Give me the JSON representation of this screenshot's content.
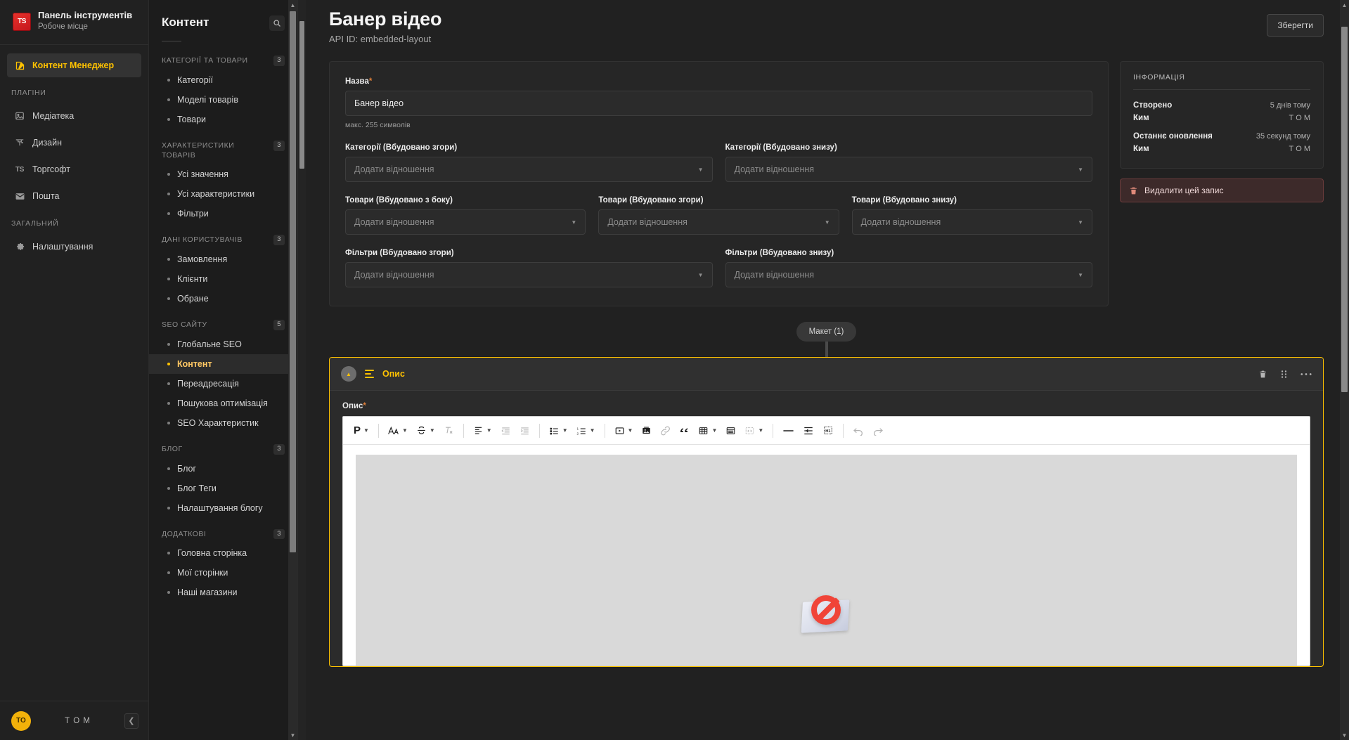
{
  "brand": {
    "logo_text": "TS",
    "title": "Панель інструментів",
    "subtitle": "Робоче місце"
  },
  "leftnav": {
    "primary": {
      "label": "Контент Менеджер",
      "icon": "pencil-square-icon"
    },
    "sections": [
      {
        "heading": "ПЛАГІНИ",
        "items": [
          {
            "label": "Медіатека",
            "icon": "image-icon"
          },
          {
            "label": "Дизайн",
            "icon": "design-icon"
          },
          {
            "label": "Торгсофт",
            "icon": "ts-icon"
          },
          {
            "label": "Пошта",
            "icon": "mail-icon"
          }
        ]
      },
      {
        "heading": "ЗАГАЛЬНИЙ",
        "items": [
          {
            "label": "Налаштування",
            "icon": "gear-icon"
          }
        ]
      }
    ],
    "footer": {
      "avatar_initials": "ТО",
      "user": "Т О М",
      "collapse_icon": "chevron-left-icon"
    }
  },
  "listpane": {
    "title": "Контент",
    "search_icon": "search-icon",
    "groups": [
      {
        "heading": "КАТЕГОРІЇ ТА ТОВАРИ",
        "count": "3",
        "items": [
          {
            "label": "Категорії",
            "active": false
          },
          {
            "label": "Моделі товарів",
            "active": false
          },
          {
            "label": "Товари",
            "active": false
          }
        ]
      },
      {
        "heading": "ХАРАКТЕРИСТИКИ ТОВАРІВ",
        "count": "3",
        "items": [
          {
            "label": "Усі значення",
            "active": false
          },
          {
            "label": "Усі характеристики",
            "active": false
          },
          {
            "label": "Фільтри",
            "active": false
          }
        ]
      },
      {
        "heading": "ДАНІ КОРИСТУВАЧІВ",
        "count": "3",
        "items": [
          {
            "label": "Замовлення",
            "active": false
          },
          {
            "label": "Клієнти",
            "active": false
          },
          {
            "label": "Обране",
            "active": false
          }
        ]
      },
      {
        "heading": "SEO САЙТУ",
        "count": "5",
        "items": [
          {
            "label": "Глобальне SEO",
            "active": false
          },
          {
            "label": "Контент",
            "active": true
          },
          {
            "label": "Переадресація",
            "active": false
          },
          {
            "label": "Пошукова оптимізація",
            "active": false
          },
          {
            "label": "SEO Характеристик",
            "active": false
          }
        ]
      },
      {
        "heading": "БЛОГ",
        "count": "3",
        "items": [
          {
            "label": "Блог",
            "active": false
          },
          {
            "label": "Блог Теги",
            "active": false
          },
          {
            "label": "Налаштування блогу",
            "active": false
          }
        ]
      },
      {
        "heading": "ДОДАТКОВІ",
        "count": "3",
        "items": [
          {
            "label": "Головна сторінка",
            "active": false
          },
          {
            "label": "Мої сторінки",
            "active": false
          },
          {
            "label": "Наші магазини",
            "active": false
          }
        ]
      }
    ]
  },
  "header": {
    "title": "Банер відео",
    "api_id": "API ID: embedded-layout",
    "save_label": "Зберегти"
  },
  "form": {
    "name_label": "Назва",
    "name_required": "*",
    "name_value": "Банер відео",
    "name_hint": "макс. 255 символів",
    "relation_placeholder": "Додати відношення",
    "rows": [
      [
        {
          "label": "Категорії (Вбудовано згори)",
          "placeholder": "Додати відношення"
        },
        {
          "label": "Категорії (Вбудовано знизу)",
          "placeholder": "Додати відношення"
        }
      ],
      [
        {
          "label": "Товари (Вбудовано з боку)",
          "placeholder": "Додати відношення"
        },
        {
          "label": "Товари (Вбудовано згори)",
          "placeholder": "Додати відношення"
        },
        {
          "label": "Товари (Вбудовано знизу)",
          "placeholder": "Додати відношення"
        }
      ],
      [
        {
          "label": "Фільтри (Вбудовано згори)",
          "placeholder": "Додати відношення"
        },
        {
          "label": "Фільтри (Вбудовано знизу)",
          "placeholder": "Додати відношення"
        }
      ]
    ]
  },
  "info": {
    "heading": "ІНФОРМАЦІЯ",
    "rows": [
      {
        "key": "Створено",
        "value": "5 днів тому"
      },
      {
        "key": "Ким",
        "value": "Т О М"
      },
      {
        "key": "Останнє оновлення",
        "value": "35 секунд тому"
      },
      {
        "key": "Ким",
        "value": "Т О М"
      }
    ],
    "delete_label": "Видалити цей запис",
    "delete_icon": "trash-icon"
  },
  "dynamic_zone": {
    "badge": "Макет (1)",
    "component": {
      "name": "Опис",
      "collapse_icon": "chevron-up-icon",
      "drag_icon": "drag-lines-icon",
      "actions": [
        {
          "icon": "trash-icon",
          "name": "delete-component"
        },
        {
          "icon": "grid-dots-icon",
          "name": "reorder-component"
        },
        {
          "icon": "ellipsis-icon",
          "name": "more-options"
        }
      ]
    },
    "editor": {
      "field_label": "Опис",
      "field_required": "*",
      "toolbar": [
        {
          "icon": "paragraph-icon",
          "glyph": "P",
          "caret": true,
          "name": "paragraph-style"
        },
        {
          "sep": true
        },
        {
          "icon": "font-size-icon",
          "glyph": "Aa",
          "caret": true,
          "name": "font-size"
        },
        {
          "icon": "strikethrough-icon",
          "glyph": "S",
          "caret": true,
          "name": "strikethrough"
        },
        {
          "icon": "clear-format-icon",
          "glyph": "Tx",
          "caret": false,
          "name": "clear-formatting",
          "dim": true
        },
        {
          "sep": true
        },
        {
          "icon": "align-icon",
          "glyph": "align",
          "caret": true,
          "name": "text-align"
        },
        {
          "icon": "outdent-icon",
          "glyph": "outdent",
          "caret": false,
          "name": "decrease-indent",
          "dim": true
        },
        {
          "icon": "indent-icon",
          "glyph": "indent",
          "caret": false,
          "name": "increase-indent",
          "dim": true
        },
        {
          "sep": true
        },
        {
          "icon": "bullet-list-icon",
          "glyph": "ul",
          "caret": true,
          "name": "bullet-list"
        },
        {
          "icon": "numbered-list-icon",
          "glyph": "ol",
          "caret": true,
          "name": "numbered-list"
        },
        {
          "sep": true
        },
        {
          "icon": "video-icon",
          "glyph": "video",
          "caret": true,
          "name": "insert-video"
        },
        {
          "icon": "image-icon",
          "glyph": "image",
          "caret": false,
          "name": "insert-image"
        },
        {
          "icon": "link-icon",
          "glyph": "link",
          "caret": false,
          "name": "insert-link",
          "dim": true
        },
        {
          "icon": "quote-icon",
          "glyph": "quote",
          "caret": false,
          "name": "blockquote"
        },
        {
          "icon": "table-icon",
          "glyph": "table",
          "caret": true,
          "name": "insert-table"
        },
        {
          "icon": "html-icon",
          "glyph": "html",
          "caret": false,
          "name": "html-block"
        },
        {
          "icon": "code-embed-icon",
          "glyph": "embed",
          "caret": true,
          "name": "code-embed",
          "dim": true
        },
        {
          "sep": true
        },
        {
          "icon": "horizontal-rule-icon",
          "glyph": "hr",
          "caret": false,
          "name": "horizontal-rule"
        },
        {
          "icon": "page-break-icon",
          "glyph": "pagebreak",
          "caret": false,
          "name": "page-break"
        },
        {
          "icon": "heading-icon",
          "glyph": "H1",
          "caret": false,
          "name": "heading-block"
        },
        {
          "sep": true
        },
        {
          "icon": "undo-icon",
          "glyph": "undo",
          "caret": false,
          "name": "undo",
          "dim": true
        },
        {
          "icon": "redo-icon",
          "glyph": "redo",
          "caret": false,
          "name": "redo",
          "dim": true
        }
      ],
      "canvas_content_icon": "broken-image-icon"
    }
  },
  "colors": {
    "accent": "#ffc200",
    "danger": "#6b3c3c",
    "page_bg": "#212121",
    "panel_bg": "#262626"
  }
}
